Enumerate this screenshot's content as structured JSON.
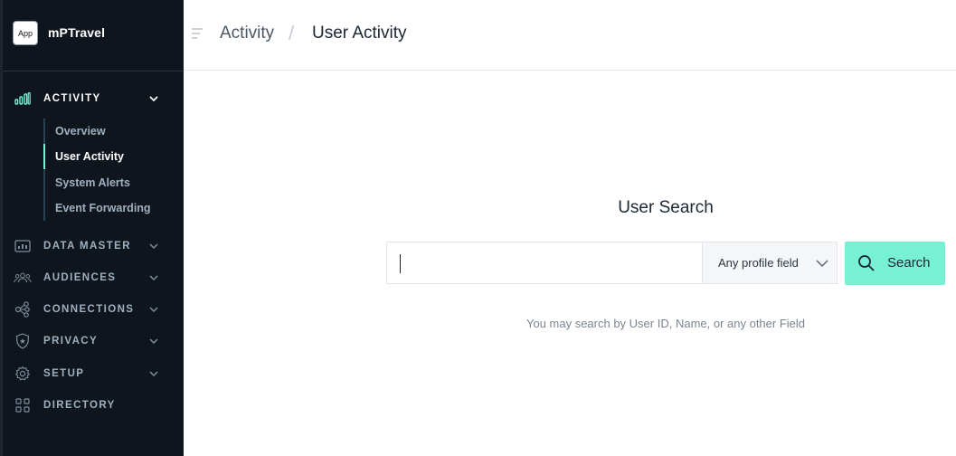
{
  "app": {
    "badge": "App",
    "name": "mPTravel"
  },
  "sidebar": {
    "activity": {
      "label": "ACTIVITY",
      "icon": "bar-chart-icon"
    },
    "activity_items": [
      {
        "label": "Overview"
      },
      {
        "label": "User Activity"
      },
      {
        "label": "System Alerts"
      },
      {
        "label": "Event Forwarding"
      }
    ],
    "sections": [
      {
        "label": "DATA MASTER",
        "icon": "data-master-icon"
      },
      {
        "label": "AUDIENCES",
        "icon": "audiences-icon"
      },
      {
        "label": "CONNECTIONS",
        "icon": "connections-icon"
      },
      {
        "label": "PRIVACY",
        "icon": "privacy-shield-icon"
      },
      {
        "label": "SETUP",
        "icon": "gear-icon"
      },
      {
        "label": "DIRECTORY",
        "icon": "grid-icon"
      }
    ]
  },
  "header": {
    "breadcrumb_parent": "Activity",
    "breadcrumb_separator": "/",
    "breadcrumb_current": "User Activity"
  },
  "search": {
    "title": "User Search",
    "value": "",
    "field_select": "Any profile field",
    "button_label": "Search",
    "hint": "You may search by User ID, Name, or any other Field"
  },
  "colors": {
    "sidebar_bg": "#0f151c",
    "accent": "#78f0d4",
    "active_indicator": "#78f0d4"
  }
}
